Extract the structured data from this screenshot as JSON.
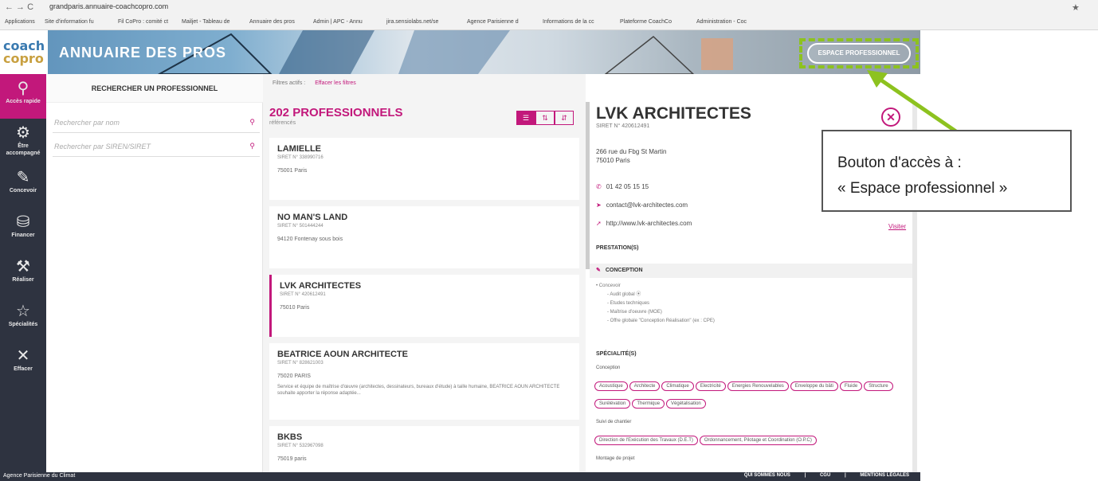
{
  "browser": {
    "nav": "← → C",
    "url": "grandparis.annuaire-coachcopro.com",
    "star": "★",
    "bookmarks": [
      "Applications",
      "Site d'information fu",
      "Fil CoPro : comité ct",
      "Mailjet - Tableau de",
      "Annuaire des pros",
      "Admin | APC - Annu",
      "jira.sensiolabs.net/se",
      "Agence Parisienne d",
      "Informations de la cc",
      "Plateforme CoachCo",
      "Administration - Coc"
    ]
  },
  "header": {
    "logo_line1": "coach",
    "logo_line2": "copro",
    "title": "ANNUAIRE DES PROS",
    "espace_button": "ESPACE PROFESSIONNEL"
  },
  "sidebar": {
    "items": [
      {
        "icon": "⚲",
        "label": "Accès rapide"
      },
      {
        "icon": "⚙",
        "label": "Être accompagné"
      },
      {
        "icon": "✎",
        "label": "Concevoir"
      },
      {
        "icon": "⛁",
        "label": "Financer"
      },
      {
        "icon": "⚒",
        "label": "Réaliser"
      },
      {
        "icon": "☆",
        "label": "Spécialités"
      },
      {
        "icon": "✕",
        "label": "Effacer"
      }
    ]
  },
  "search": {
    "heading": "RECHERCHER UN PROFESSIONNEL",
    "name_placeholder": "Rechercher par nom",
    "siren_placeholder": "Rechercher par SIREN/SIRET"
  },
  "results": {
    "filters_label": "Filtres actifs :",
    "clear_filters": "Effacer les filtres",
    "count": "202 PROFESSIONNELS",
    "refs_label": "référencés",
    "view_icons": [
      "☰",
      "⇅",
      "⇵"
    ],
    "cards": [
      {
        "name": "LAMIELLE",
        "siret": "SIRET N° 338990716",
        "addr": "75001 Paris",
        "desc": ""
      },
      {
        "name": "NO MAN'S LAND",
        "siret": "SIRET N° 501444244",
        "addr": "94120 Fontenay sous bois",
        "desc": ""
      },
      {
        "name": "LVK ARCHITECTES",
        "siret": "SIRET N° 420612491",
        "addr": "75010 Paris",
        "desc": ""
      },
      {
        "name": "BEATRICE AOUN ARCHITECTE",
        "siret": "SIRET N° 828621003",
        "addr": "75020 PARIS",
        "desc": "Service et équipe de maîtrise d'œuvre (architectes, dessinateurs, bureaux d'étude) à taille humaine, BEATRICE AOUN ARCHITECTE souhaite apporter la réponse adaptée..."
      },
      {
        "name": "BKBS",
        "siret": "SIRET N° 532967098",
        "addr": "75019 paris",
        "desc": ""
      }
    ]
  },
  "detail": {
    "title": "LVK ARCHITECTES",
    "siret": "SIRET N° 420612491",
    "addr1": "266 rue du Fbg St Martin",
    "addr2": "75010 Paris",
    "phone": "01 42 05 15 15",
    "email": "contact@lvk-architectes.com",
    "website": "http://www.lvk-architectes.com",
    "visit": "Visiter",
    "prestations_title": "PRESTATION(S)",
    "conception_band": "CONCEPTION",
    "concevoir": "• Concevoir",
    "sub_items": [
      "- Audit global ⦿",
      "- Etudes techniques",
      "- Maîtrise d'oeuvre (MOE)",
      "- Offre globale \"Conception Réalisation\" (ex : CPE)"
    ],
    "specialites_title": "SPÉCIALITÉ(S)",
    "conception_label": "Conception",
    "tags_conception": [
      "Acoustique",
      "Architecte",
      "Climatique",
      "Electricité",
      "Energies Renouvelables",
      "Enveloppe du bâti",
      "Fluide",
      "Structure",
      "Surélévation",
      "Thermique",
      "Végétalisation"
    ],
    "suivi_label": "Suivi de chantier",
    "tags_suivi": [
      "Direction de l'Exécution des Travaux (D.E.T)",
      "Ordonnancement, Pilotage et Coordination (O.P.C)"
    ],
    "montage_label": "Montage de projet"
  },
  "footer": {
    "logo": "Agence Parisienne du Climat",
    "links": [
      "QUI SOMMES NOUS",
      "|",
      "CGU",
      "|",
      "MENTIONS LÉGALES"
    ]
  },
  "callout": {
    "line1": "Bouton d'accès à :",
    "line2": "« Espace professionnel »"
  },
  "colors": {
    "accent": "#c2187b",
    "sidebar": "#2e3340",
    "annotation": "#8dc21f"
  }
}
